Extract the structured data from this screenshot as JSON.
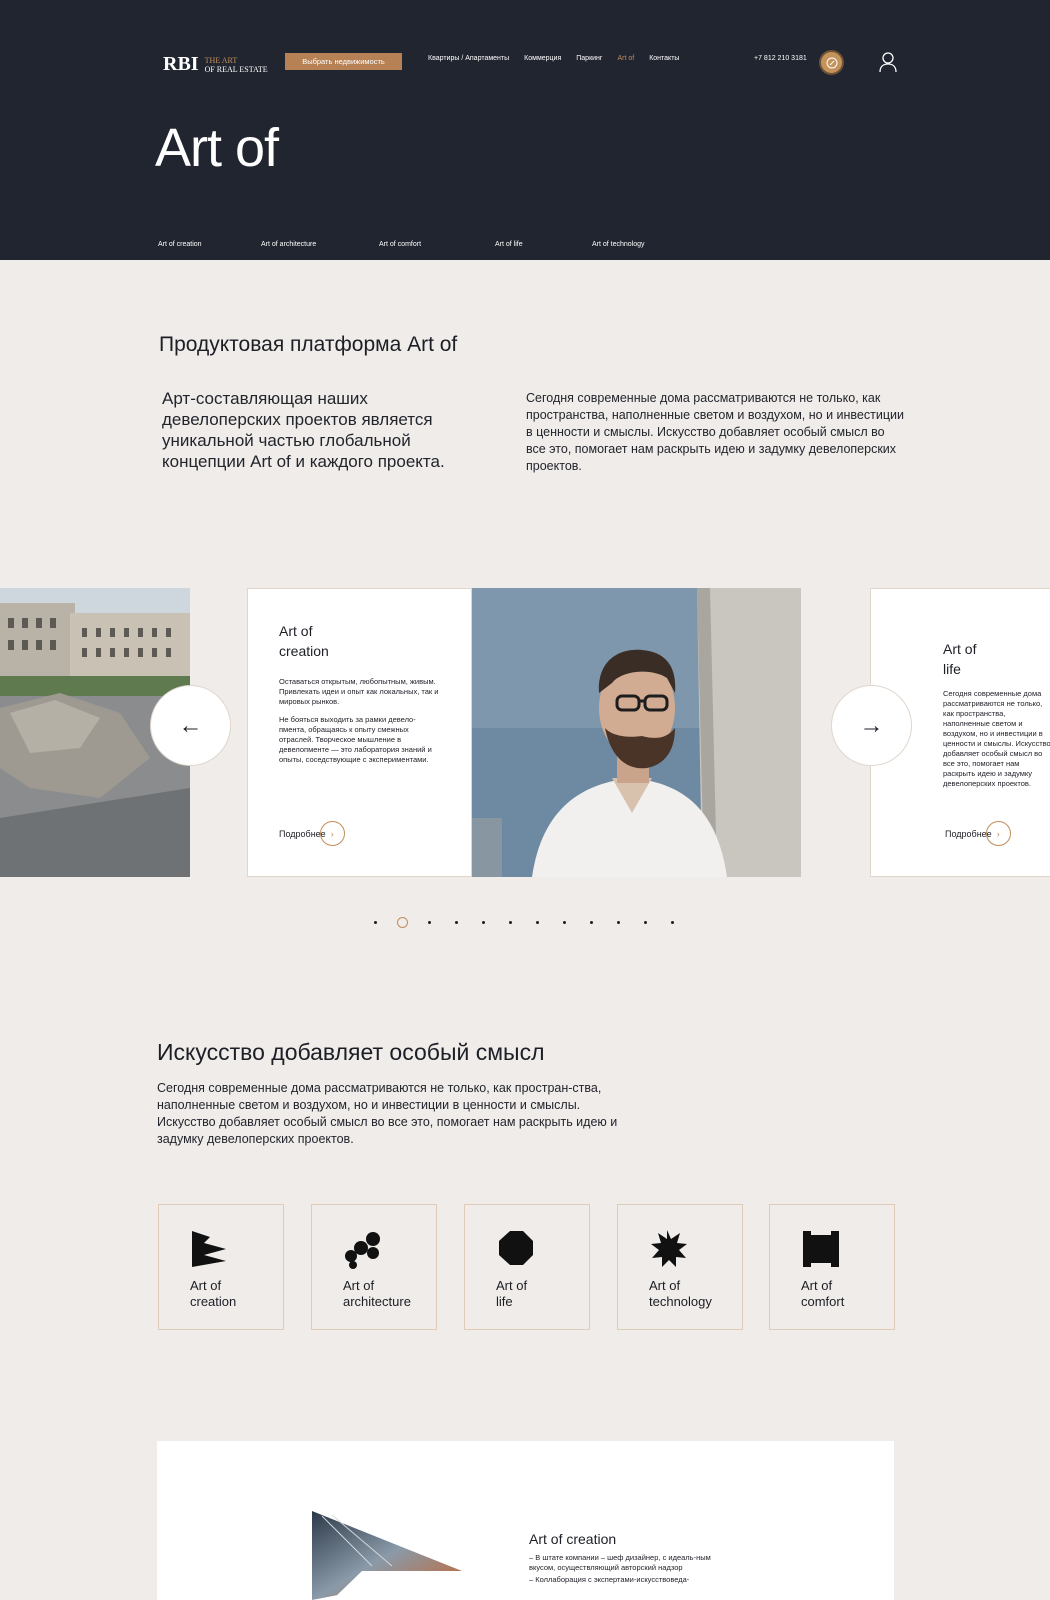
{
  "header": {
    "logo_mark": "RBI",
    "logo_line1": "THE ART",
    "logo_line2": "OF REAL ESTATE",
    "cta_label": "Выбрать недвижимость",
    "nav": [
      "Квартиры / Апартаменты",
      "Коммерция",
      "Паркинг",
      "Art of",
      "Контакты"
    ],
    "nav_active_index": 3,
    "phone": "+7 812 210 3181"
  },
  "hero": {
    "title": "Art of",
    "subnav": [
      "Art of creation",
      "Art of architecture",
      "Art of comfort",
      "Art of life",
      "Art of technology"
    ]
  },
  "platform": {
    "title": "Продуктовая платформа Art of",
    "lead": "Арт-составляющая наших девелоперских проектов является уникальной частью глобальной концепции Art of и каждого проекта.",
    "description": "Сегодня современные дома рассматриваются не только, как пространства, наполненные светом и воздухом, но и инвестиции в ценности и смыслы. Искусство добавляет особый смысл во все это, помогает нам раскрыть идею и задумку девелоперских проектов."
  },
  "slider": {
    "main_card": {
      "title": "Art of\ncreation",
      "paragraphs": [
        "Оставаться открытым, любопытным, живым. Привлекать идеи и опыт как локальных, так и мировых рынков.",
        "Не бояться выходить за рамки девело-пмента, обращаясь к опыту смежных отраслей. Творческое мышление в девелопменте — это лаборатория знаний и опыты, соседствующие с экспериментами."
      ],
      "more_label": "Подробнее"
    },
    "right_card": {
      "title": "Art of\nlife",
      "text": "Сегодня современные дома рассматриваются не только, как пространства, наполненные светом и воздухом, но и инвестиции в ценности и смыслы. Искусство добавляет особый смысл во все это, помогает нам раскрыть идею и задумку девелоперских проектов.",
      "more_label": "Подробнее"
    },
    "prev_arrow": "←",
    "next_arrow": "→",
    "more_arrow": "›",
    "dot_count": 12,
    "active_dot": 1
  },
  "art_section": {
    "title": "Искусство добавляет особый смысл",
    "description": "Сегодня современные дома рассматриваются не только, как простран-ства, наполненные светом и воздухом, но и инвестиции в ценности и смыслы. Искусство добавляет особый смысл во все это, помогает нам раскрыть идею и задумку девелоперских проектов.",
    "tiles": [
      {
        "label": "Art of\ncreation",
        "icon": "creation-icon"
      },
      {
        "label": "Art of\narchitecture",
        "icon": "architecture-icon"
      },
      {
        "label": "Art of\nlife",
        "icon": "life-icon"
      },
      {
        "label": "Art of\ntechnology",
        "icon": "technology-icon"
      },
      {
        "label": "Art of\ncomfort",
        "icon": "comfort-icon"
      }
    ]
  },
  "bottom": {
    "title": "Art of creation",
    "items": [
      "– В штате компании – шеф дизайнер, с идеаль-ным вкусом, осуществляющий авторский надзор",
      "– Коллаборация с экспертами-искусствоведа-"
    ]
  },
  "colors": {
    "dark": "#212530",
    "accent": "#b58155",
    "background": "#efece9"
  }
}
